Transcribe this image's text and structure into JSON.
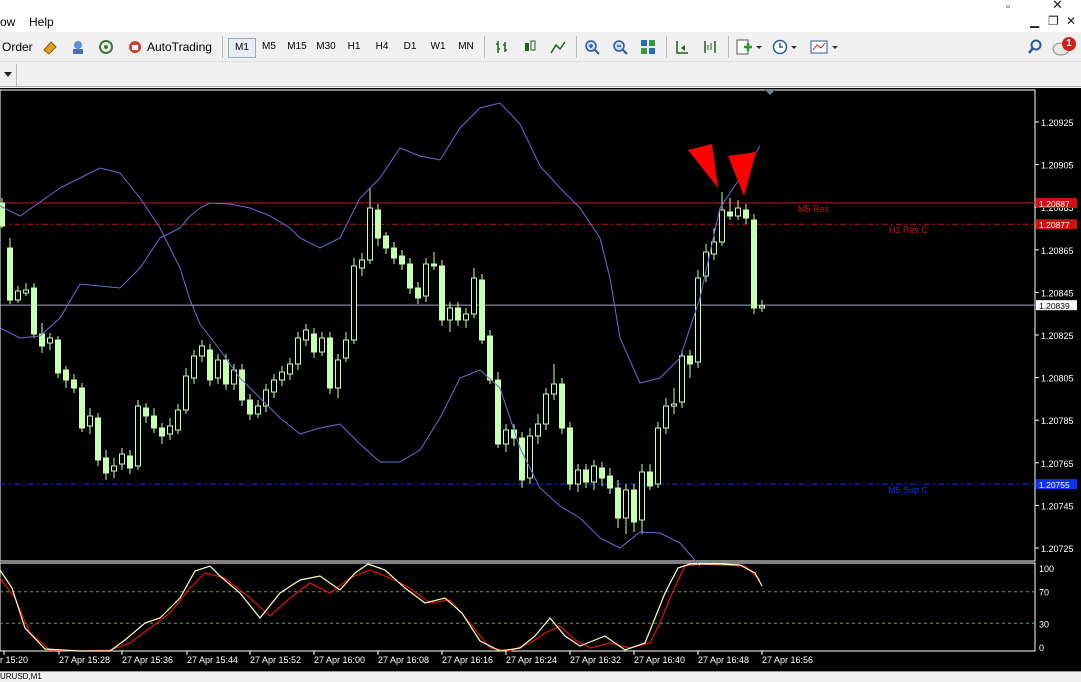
{
  "menu": {
    "window_partial": "ow",
    "help": "Help"
  },
  "toolbar": {
    "order_label": "Order",
    "autotrading_label": "AutoTrading",
    "timeframes": [
      "M1",
      "M5",
      "M15",
      "M30",
      "H1",
      "H4",
      "D1",
      "W1",
      "MN"
    ],
    "active_timeframe": "M1",
    "notification_count": "1"
  },
  "chart": {
    "symbol_tab_partial": "URUSD,M1",
    "price_labels": [
      "1.20925",
      "1.20905",
      "1.20885",
      "1.20865",
      "1.20845",
      "1.20825",
      "1.20805",
      "1.20785",
      "1.20765",
      "1.20745",
      "1.20725"
    ],
    "time_labels": [
      "r 15:20",
      "27 Apr 15:28",
      "27 Apr 15:36",
      "27 Apr 15:44",
      "27 Apr 15:52",
      "27 Apr 16:00",
      "27 Apr 16:08",
      "27 Apr 16:16",
      "27 Apr 16:24",
      "27 Apr 16:32",
      "27 Apr 16:40",
      "27 Apr 16:48",
      "27 Apr 16:56"
    ],
    "current_price": "1.20839",
    "lines": [
      {
        "name": "M5 Res",
        "price": "1.20887",
        "color": "#d01010"
      },
      {
        "name": "H1 Res C",
        "price": "1.20877",
        "color": "#d01010"
      },
      {
        "name": "M5 Sup C",
        "price": "1.20755",
        "color": "#1030ff"
      }
    ],
    "osc_labels": [
      "100",
      "70",
      "30",
      "0"
    ],
    "colors": {
      "bull": "#c8ffb0",
      "bear": "#c8ffb0",
      "band": "#6b6bd8",
      "main": "#ffffc0",
      "signal": "#e01010"
    }
  }
}
